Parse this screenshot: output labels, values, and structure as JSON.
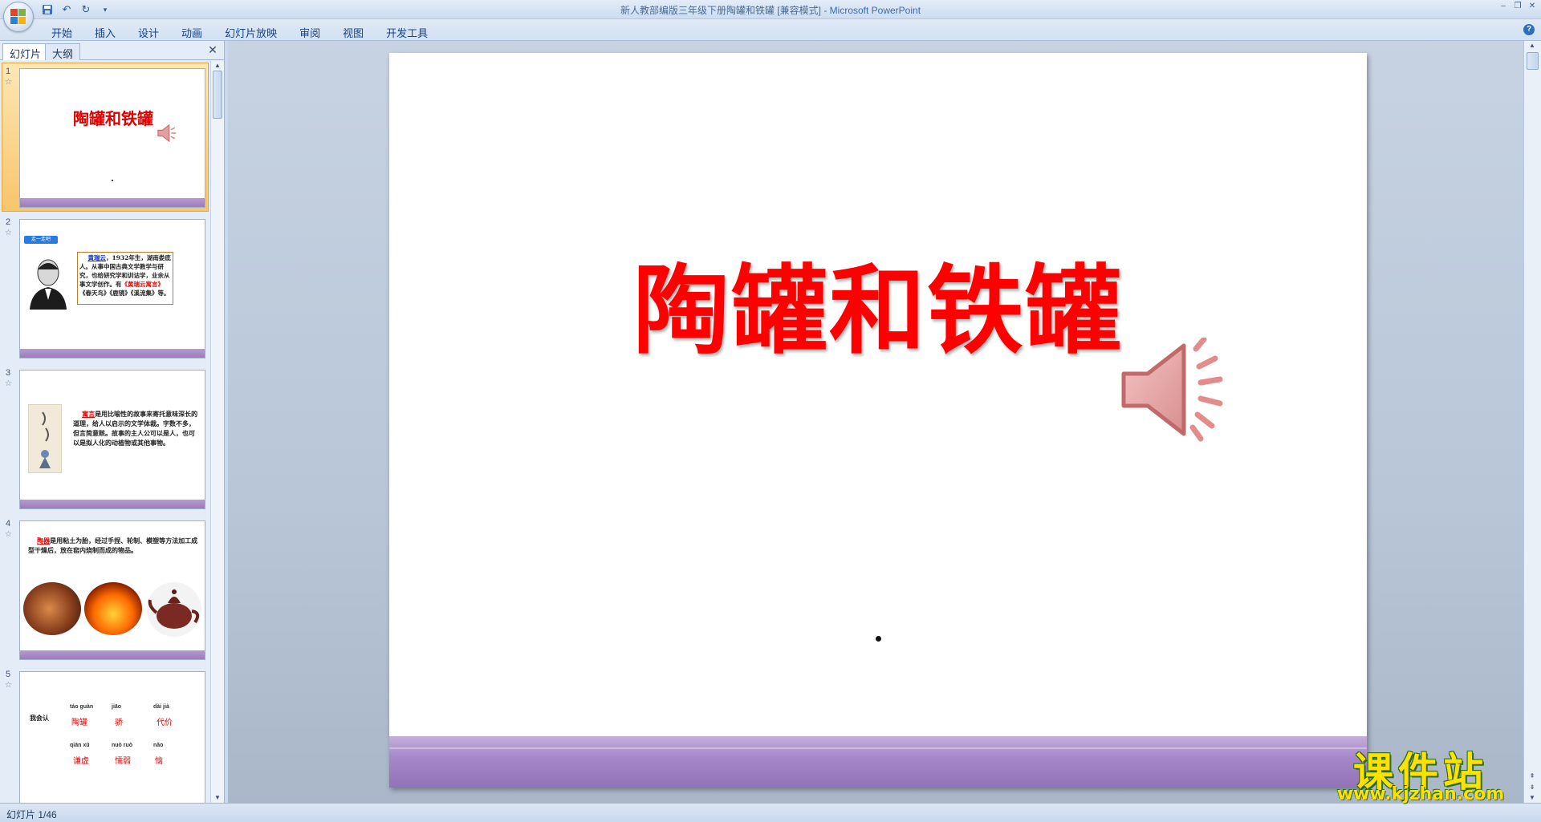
{
  "window": {
    "title_doc": "新人教部编版三年级下册陶罐和铁罐 [兼容模式]",
    "title_sep": " - ",
    "title_app": "Microsoft PowerPoint"
  },
  "menu": {
    "tabs": [
      "开始",
      "插入",
      "设计",
      "动画",
      "幻灯片放映",
      "审阅",
      "视图",
      "开发工具"
    ]
  },
  "panel": {
    "tab_slides": "幻灯片",
    "tab_outline": "大纲",
    "thumbs": [
      {
        "num": "1",
        "title": "陶罐和铁罐"
      },
      {
        "num": "2",
        "badge": "走一走吧",
        "lines": [
          "黄瑞云",
          "，1932年生，湖南娄底人。从事中国古典文学教学与研究，也给研究学和训诂学，业余从事文学创作。有",
          "《黄瑞云寓言》",
          "《春天鸟》《鹿镜》《溪流集》等。"
        ]
      },
      {
        "num": "3",
        "lines": [
          "寓言",
          "是用比喻性的故事来寄托意味深长的道理，给人以启示的文学体裁。字数不多，但言简意赅。故事的主人公可以是人，也可以是拟人化的动植物或其他事物。"
        ]
      },
      {
        "num": "4",
        "lines": [
          "陶器",
          "是用粘土为胎，经过手捏、轮制、模塑等方法加工成型干燥后，放在窑内烧制而成的物品。"
        ]
      },
      {
        "num": "5",
        "label": "我会认",
        "words": [
          {
            "pinyin": "táo guàn",
            "han": "陶罐"
          },
          {
            "pinyin": "jiāo",
            "han": "骄"
          },
          {
            "pinyin": "dài jià",
            "han": "代价"
          },
          {
            "pinyin": "qiān xū",
            "han": "谦虚"
          },
          {
            "pinyin": "nuò ruò",
            "han": "懦弱"
          },
          {
            "pinyin": "nǎo",
            "han": "恼"
          }
        ]
      }
    ]
  },
  "slide": {
    "title": "陶罐和铁罐"
  },
  "status": {
    "text": "幻灯片 1/46"
  },
  "watermark": {
    "big": "课件站",
    "small": "www.kjzhan.com"
  },
  "colors": {
    "title_red": "#ff0000",
    "band_purple": "#9b7cbd",
    "selection": "#f7c56a"
  }
}
